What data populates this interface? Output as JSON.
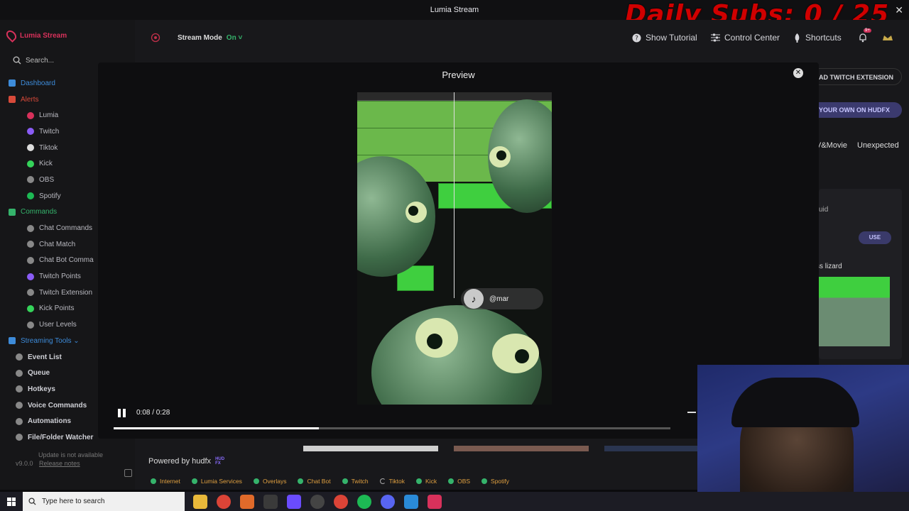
{
  "window": {
    "title": "Lumia Stream",
    "close": "✕"
  },
  "overlay": {
    "daily_subs": "Daily Subs:  0 / 25"
  },
  "sidebar": {
    "brand": "Lumia Stream",
    "search_placeholder": "Search...",
    "items": [
      {
        "label": "Dashboard",
        "kind": "section",
        "color": "#3d8bd9"
      },
      {
        "label": "Alerts",
        "kind": "section",
        "color": "#d84a3a"
      },
      {
        "label": "Lumia",
        "kind": "sub",
        "color": "#d8315b"
      },
      {
        "label": "Twitch",
        "kind": "sub",
        "color": "#8a5cf6"
      },
      {
        "label": "Tiktok",
        "kind": "sub",
        "color": "#dddddd"
      },
      {
        "label": "Kick",
        "kind": "sub",
        "color": "#35d35a"
      },
      {
        "label": "OBS",
        "kind": "sub",
        "color": "#888888"
      },
      {
        "label": "Spotify",
        "kind": "sub",
        "color": "#1db954"
      },
      {
        "label": "Commands",
        "kind": "section",
        "color": "#35b36b"
      },
      {
        "label": "Chat Commands",
        "kind": "sub",
        "color": "#888888"
      },
      {
        "label": "Chat Match",
        "kind": "sub",
        "color": "#888888"
      },
      {
        "label": "Chat Bot Comma",
        "kind": "sub",
        "color": "#888888"
      },
      {
        "label": "Twitch Points",
        "kind": "sub",
        "color": "#8a5cf6"
      },
      {
        "label": "Twitch Extension",
        "kind": "sub",
        "color": "#888888"
      },
      {
        "label": "Kick Points",
        "kind": "sub",
        "color": "#35d35a"
      },
      {
        "label": "User Levels",
        "kind": "sub",
        "color": "#888888"
      },
      {
        "label": "Streaming Tools ⌄",
        "kind": "section",
        "color": "#3d8bd9"
      },
      {
        "label": "Event List",
        "kind": "top",
        "color": "#888888"
      },
      {
        "label": "Queue",
        "kind": "top",
        "color": "#888888"
      },
      {
        "label": "Hotkeys",
        "kind": "top",
        "color": "#888888"
      },
      {
        "label": "Voice Commands",
        "kind": "top",
        "color": "#888888"
      },
      {
        "label": "Automations",
        "kind": "top",
        "color": "#888888"
      },
      {
        "label": "File/Folder Watcher",
        "kind": "top",
        "color": "#888888"
      }
    ],
    "update_text": "Update is not available",
    "version": "v9.0.0",
    "release_notes": "Release notes"
  },
  "header": {
    "stream_mode_label": "Stream Mode",
    "stream_mode_state": "On ˅",
    "show_tutorial": "Show Tutorial",
    "control_center": "Control Center",
    "shortcuts": "Shortcuts",
    "bell_badge": "9+"
  },
  "modal": {
    "title": "Preview",
    "close": "✕",
    "tiktok_handle": "@mar",
    "time": "0:08 / 0:28",
    "progress": 0.369
  },
  "right_pane": {
    "twitch_extension": "AD TWITCH EXTENSION",
    "hudfx": "YOUR OWN ON HUDFX",
    "tag1": "V&Movie",
    "tag2": "Unexpected",
    "card_snippet": "uid",
    "use": "USE",
    "card_title": "ss lizard"
  },
  "footer": {
    "powered_by": "Powered by hudfx",
    "hud_logo": "HUD FX"
  },
  "status": [
    {
      "label": "Internet",
      "state": "ok"
    },
    {
      "label": "Lumia Services",
      "state": "ok"
    },
    {
      "label": "Overlays",
      "state": "ok"
    },
    {
      "label": "Chat Bot",
      "state": "ok"
    },
    {
      "label": "Twitch",
      "state": "ok"
    },
    {
      "label": "Tiktok",
      "state": "loading"
    },
    {
      "label": "Kick",
      "state": "ok"
    },
    {
      "label": "OBS",
      "state": "ok"
    },
    {
      "label": "Spotify",
      "state": "ok"
    }
  ],
  "taskbar": {
    "search_placeholder": "Type here to search",
    "apps": [
      "file-explorer",
      "chrome",
      "app-star",
      "app-x",
      "app-grid",
      "app-circle",
      "chrome-2",
      "spotify",
      "discord",
      "app-f",
      "lumia-stream"
    ]
  }
}
